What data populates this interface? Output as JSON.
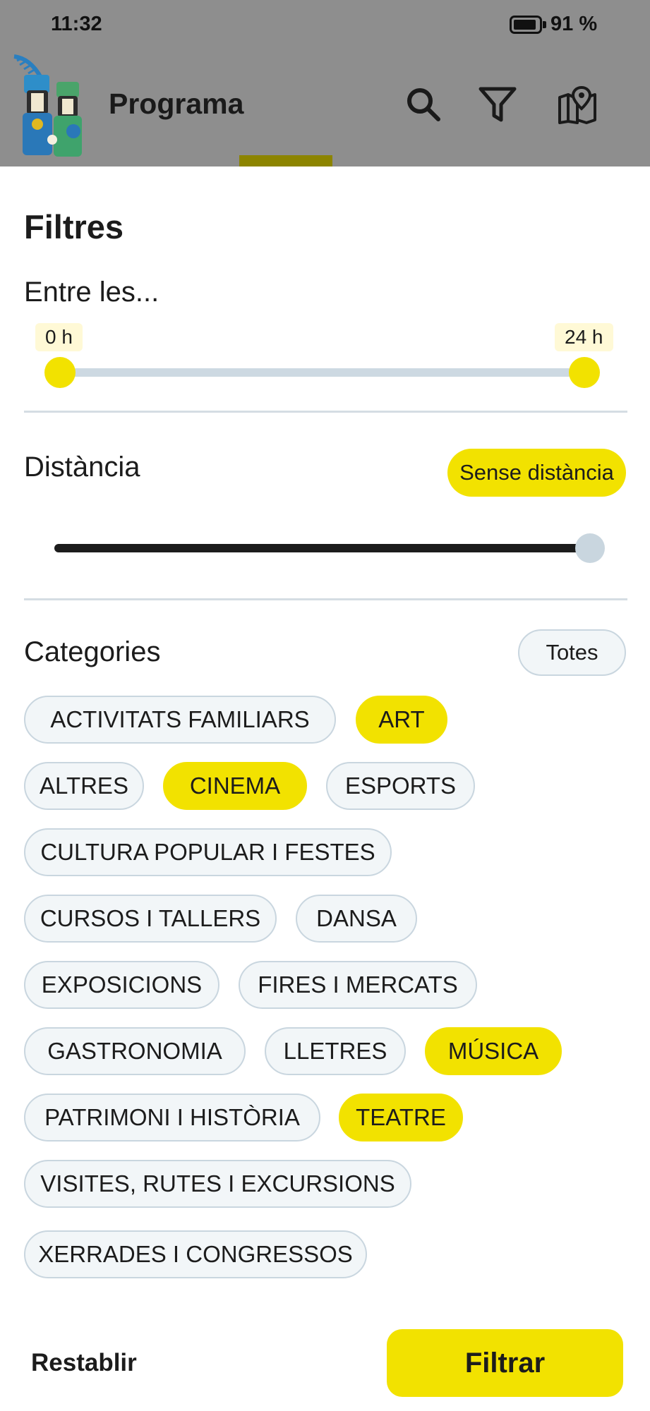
{
  "status_bar": {
    "time": "11:32",
    "battery_percent": "91 %",
    "battery_level": 0.91
  },
  "app_bar": {
    "title": "Programa",
    "icons": [
      "search-icon",
      "filter-icon",
      "map-icon"
    ]
  },
  "filters": {
    "title": "Filtres",
    "time_range": {
      "label": "Entre les...",
      "min_label": "0 h",
      "max_label": "24 h",
      "min_value": 0,
      "max_value": 24
    },
    "distance": {
      "label": "Distància",
      "badge": "Sense distància",
      "value": 1.0
    },
    "categories": {
      "label": "Categories",
      "all_button": "Totes",
      "items": [
        {
          "label": "ACTIVITATS FAMILIARS",
          "selected": false
        },
        {
          "label": "ART",
          "selected": true
        },
        {
          "label": "ALTRES",
          "selected": false
        },
        {
          "label": "CINEMA",
          "selected": true
        },
        {
          "label": "ESPORTS",
          "selected": false
        },
        {
          "label": "CULTURA POPULAR I FESTES",
          "selected": false
        },
        {
          "label": "CURSOS I TALLERS",
          "selected": false
        },
        {
          "label": "DANSA",
          "selected": false
        },
        {
          "label": "EXPOSICIONS",
          "selected": false
        },
        {
          "label": "FIRES I MERCATS",
          "selected": false
        },
        {
          "label": "GASTRONOMIA",
          "selected": false
        },
        {
          "label": "LLETRES",
          "selected": false
        },
        {
          "label": "MÚSICA",
          "selected": true
        },
        {
          "label": "PATRIMONI I HISTÒRIA",
          "selected": false
        },
        {
          "label": "TEATRE",
          "selected": true
        },
        {
          "label": "VISITES, RUTES I EXCURSIONS",
          "selected": false
        },
        {
          "label": "XERRADES I CONGRESSOS",
          "selected": false
        }
      ]
    },
    "footer": {
      "reset_label": "Restablir",
      "apply_label": "Filtrar"
    }
  },
  "colors": {
    "accent": "#f2e200",
    "chip_border": "#c9d6df",
    "chip_bg": "#f2f6f8",
    "overlay": "#8e8e8e",
    "text": "#1c1c1c"
  }
}
